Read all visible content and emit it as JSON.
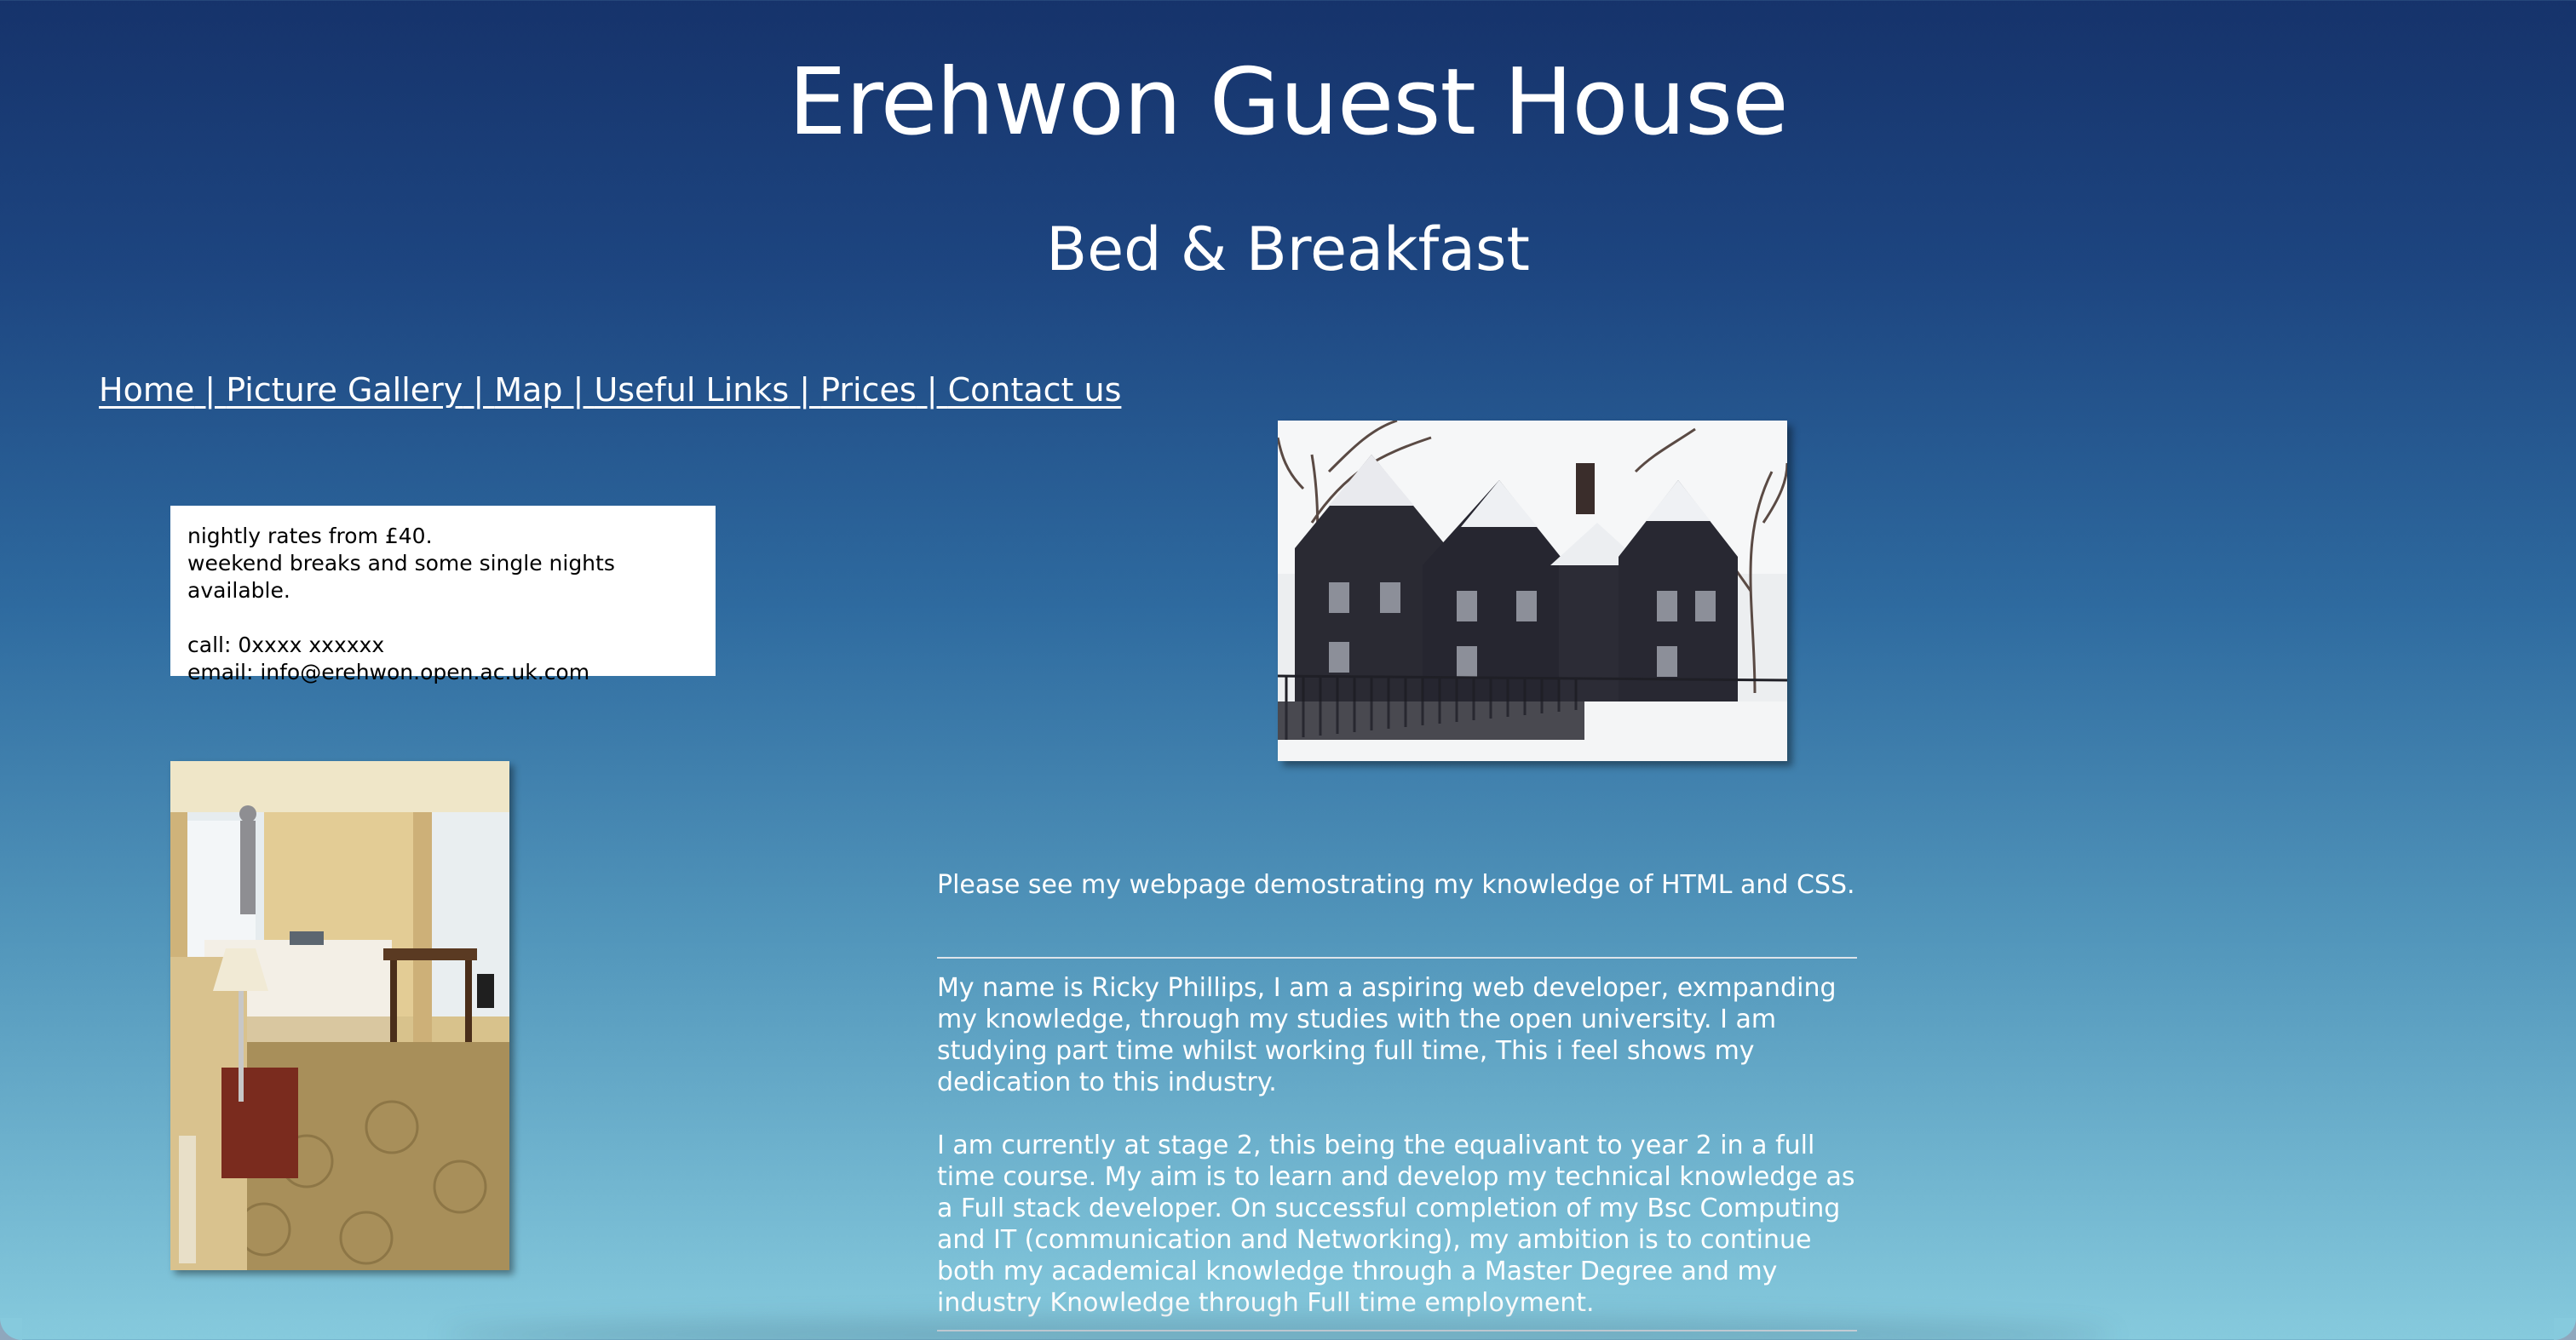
{
  "header": {
    "title": "Erehwon Guest House",
    "subtitle": "Bed & Breakfast"
  },
  "nav": {
    "items": [
      {
        "label": "Home"
      },
      {
        "label": "Picture Gallery"
      },
      {
        "label": "Map"
      },
      {
        "label": "Useful Links"
      },
      {
        "label": "Prices"
      },
      {
        "label": "Contact us"
      }
    ],
    "separator": " | "
  },
  "info_box": {
    "rates": "nightly rates from £40.",
    "breaks": "weekend breaks and some single nights available.",
    "call": "call: 0xxxx xxxxxx",
    "email": "email: info@erehwon.open.ac.uk.com"
  },
  "images": {
    "house": "winter-house-photo",
    "room": "hotel-room-photo"
  },
  "main": {
    "intro": "Please see my webpage demostrating my knowledge of HTML and CSS.",
    "bio_1": "My name is Ricky Phillips, I am a aspiring web developer, exmpanding my knowledge, through my studies with the open university. I am studying part time whilst working full time, This i feel shows my dedication to this industry.",
    "bio_2": "I am currently at stage 2, this being the equalivant to year 2 in a full time course. My aim is to learn and develop my technical knowledge as a Full stack developer. On successful completion of my Bsc Computing and IT (communication and Networking), my ambition is to continue both my academical knowledge through a Master Degree and my industry Knowledge through Full time employment."
  },
  "colors": {
    "bg_top": "#16336b",
    "bg_bottom": "#86cadd",
    "text": "#ffffff"
  }
}
